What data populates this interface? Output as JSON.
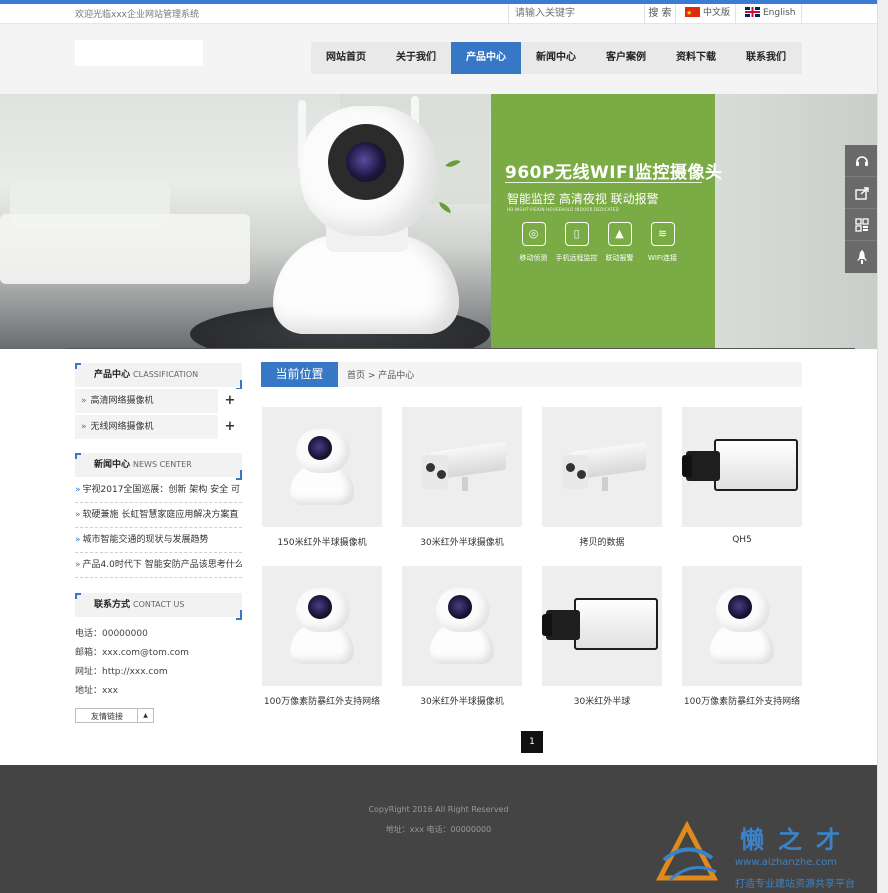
{
  "topbar": {
    "welcome": "欢迎光临xxx企业网站管理系统",
    "search_placeholder": "请输入关键字",
    "search_button": "搜 索",
    "lang_cn": "中文版",
    "lang_en": "English"
  },
  "nav": {
    "items": [
      "网站首页",
      "关于我们",
      "产品中心",
      "新闻中心",
      "客户案例",
      "资料下载",
      "联系我们"
    ],
    "active": "产品中心"
  },
  "banner": {
    "title": "960P无线WIFI监控摄像头",
    "subtitle": "智能监控 高清夜视 联动报警",
    "tiny": "HD NIGHT-VISION HOUSEHOLD INDOOR DEDICATED",
    "features": [
      "移动侦测",
      "手机远程监控",
      "联动报警",
      "WIFI连接"
    ]
  },
  "side_float": {
    "icons": [
      "headset-icon",
      "share-icon",
      "qrcode-icon",
      "rocket-icon"
    ]
  },
  "products_box": {
    "title": "产品中心",
    "title_en": "CLASSIFICATION",
    "items": [
      "高清网络摄像机",
      "无线网络摄像机"
    ]
  },
  "news_box": {
    "title": "新闻中心",
    "title_en": "NEWS CENTER",
    "items": [
      "宇视2017全国巡展：创新 架构 安全 可",
      "软硬兼施 长虹智慧家庭应用解决方案直",
      "城市智能交通的现状与发展趋势",
      "产品4.0时代下 智能安防产品该思考什么"
    ]
  },
  "contact_box": {
    "title": "联系方式",
    "title_en": "CONTACT US",
    "phone": "电话：00000000",
    "email": "邮箱：xxx.com@tom.com",
    "website": "网址：http://xxx.com",
    "address": "地址：xxx"
  },
  "friend_link": {
    "label": "友情链接"
  },
  "breadcrumb": {
    "title": "当前位置",
    "path": "首页 > 产品中心"
  },
  "products": [
    {
      "name": "150米红外半球摄像机",
      "kind": "dome"
    },
    {
      "name": "30米红外半球摄像机",
      "kind": "bullet"
    },
    {
      "name": "拷贝的数据",
      "kind": "bullet"
    },
    {
      "name": "QH5",
      "kind": "box"
    },
    {
      "name": "100万像素防暴红外支持网络",
      "kind": "dome"
    },
    {
      "name": "30米红外半球摄像机",
      "kind": "dome"
    },
    {
      "name": "30米红外半球",
      "kind": "box"
    },
    {
      "name": "100万像素防暴红外支持网络",
      "kind": "dome"
    }
  ],
  "pagination": {
    "current": "1"
  },
  "footer": {
    "copyright": "CopyRight 2016 All Right Reserved",
    "contact": "地址：xxx  电话：00000000"
  },
  "watermark": {
    "brand": "懒之才",
    "url": "www.aizhanzhe.com",
    "slogan": "打造专业建站资源共享平台"
  },
  "colors": {
    "accent": "#3778c6",
    "banner_green": "#7bab45",
    "footer_bg": "#444444"
  }
}
